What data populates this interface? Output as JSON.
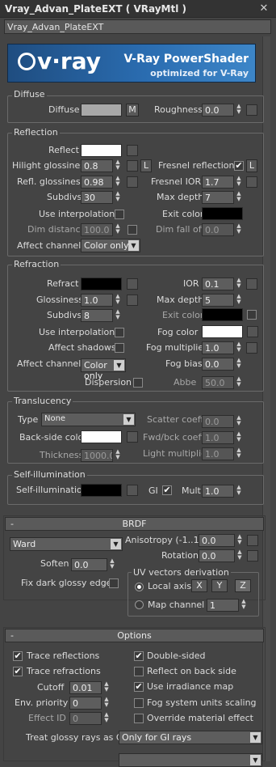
{
  "window": {
    "title": "Vray_Advan_PlateEXT  ( VRayMtl )",
    "close": "✕"
  },
  "material_name": "Vray_Advan_PlateEXT",
  "banner": {
    "logo": "v·ray",
    "title": "V-Ray PowerShader",
    "subtitle": "optimized for V-Ray",
    "colors": {
      "dark": "#1f4d80",
      "light": "#3d86c8"
    }
  },
  "diffuse": {
    "group": "Diffuse",
    "label": "Diffuse",
    "m_btn": "M",
    "roughness_label": "Roughness",
    "roughness": "0.0",
    "color": "#a8a8a8"
  },
  "reflection": {
    "group": "Reflection",
    "reflect": "Reflect",
    "reflect_color": "#ffffff",
    "hilight_label": "Hilight glossiness",
    "hilight": "0.8",
    "l_btn": "L",
    "fresnel_label": "Fresnel reflections",
    "fresnel_checked": "✔",
    "fresnel_l": "L",
    "refl_gloss_label": "Refl. glossiness",
    "refl_gloss": "0.98",
    "fresnel_ior_label": "Fresnel IOR",
    "fresnel_ior": "1.7",
    "subdivs_label": "Subdivs",
    "subdivs": "30",
    "max_depth_label": "Max depth",
    "max_depth": "7",
    "use_interp": "Use interpolation",
    "exit_color_label": "Exit color",
    "exit_color": "#000000",
    "dim_distance_label": "Dim distance",
    "dim_distance": "100.0",
    "dim_falloff_label": "Dim fall off",
    "dim_falloff": "0.0",
    "affect_channels_label": "Affect channels",
    "affect_channels": "Color only"
  },
  "refraction": {
    "group": "Refraction",
    "refract": "Refract",
    "refract_color": "#000000",
    "ior_label": "IOR",
    "ior": "0.1",
    "gloss_label": "Glossiness",
    "gloss": "1.0",
    "max_depth_label": "Max depth",
    "max_depth": "5",
    "subdivs_label": "Subdivs",
    "subdivs": "8",
    "exit_color_label": "Exit color",
    "exit_color": "#000000",
    "use_interp": "Use interpolation",
    "fog_color_label": "Fog color",
    "fog_color": "#ffffff",
    "affect_shadows": "Affect shadows",
    "fog_mult_label": "Fog multiplier",
    "fog_mult": "1.0",
    "affect_channels_label": "Affect channels",
    "affect_channels": "Color only",
    "fog_bias_label": "Fog bias",
    "fog_bias": "0.0",
    "dispersion": "Dispersion",
    "abbe_label": "Abbe",
    "abbe": "50.0"
  },
  "translucency": {
    "group": "Translucency",
    "type_label": "Type",
    "type": "None",
    "scatter_label": "Scatter coeff",
    "scatter": "0.0",
    "backside_label": "Back-side color",
    "backside_color": "#ffffff",
    "fwd_label": "Fwd/bck coeff",
    "fwd": "1.0",
    "thickness_label": "Thickness",
    "thickness": "1000.0",
    "light_mult_label": "Light multiplier",
    "light_mult": "1.0"
  },
  "selfillum": {
    "group": "Self-illumination",
    "label": "Self-illumination",
    "color": "#000000",
    "gi_label": "GI",
    "gi_checked": "✔",
    "mult_label": "Mult",
    "mult": "1.0"
  },
  "brdf": {
    "rollout": "BRDF",
    "minus": "-",
    "type": "Ward",
    "aniso_label": "Anisotropy (-1..1)",
    "aniso": "0.0",
    "rotation_label": "Rotation",
    "rotation": "0.0",
    "soften_label": "Soften",
    "soften": "0.0",
    "fix_dark": "Fix dark glossy edges",
    "uv_group": "UV vectors derivation",
    "local_axis": "Local axis",
    "x": "X",
    "y": "Y",
    "z": "Z",
    "map_channel": "Map channel",
    "map_channel_val": "1"
  },
  "options": {
    "rollout": "Options",
    "minus": "-",
    "trace_refl": "Trace reflections",
    "double_sided": "Double-sided",
    "trace_refr": "Trace refractions",
    "reflect_back": "Reflect on back side",
    "cutoff_label": "Cutoff",
    "cutoff": "0.01",
    "use_irr": "Use irradiance map",
    "env_priority_label": "Env. priority",
    "env_priority": "0",
    "fog_units": "Fog system units scaling",
    "effect_id_label": "Effect ID",
    "effect_id": "0",
    "override_effect": "Override material effect",
    "glossy_gi_label": "Treat glossy rays as GI",
    "glossy_gi": "Only for GI rays",
    "check": "✔"
  }
}
